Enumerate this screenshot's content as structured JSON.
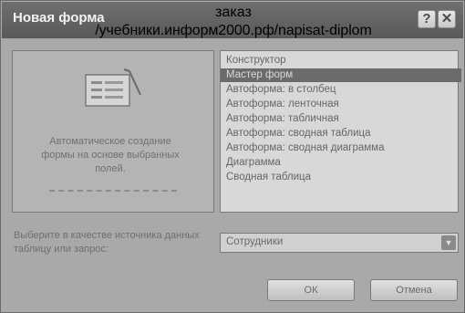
{
  "window": {
    "title": "Новая форма",
    "help_glyph": "?",
    "close_glyph": "✕"
  },
  "watermark": {
    "line1": "заказ",
    "line2": "/учебники.информ2000.рф/napisat-diplom"
  },
  "preview": {
    "description": "Автоматическое создание формы на основе выбранных полей."
  },
  "form_types": [
    {
      "label": "Конструктор",
      "selected": false
    },
    {
      "label": "Мастер форм",
      "selected": true
    },
    {
      "label": "Автоформа: в столбец",
      "selected": false
    },
    {
      "label": "Автоформа: ленточная",
      "selected": false
    },
    {
      "label": "Автоформа: табличная",
      "selected": false
    },
    {
      "label": "Автоформа: сводная таблица",
      "selected": false
    },
    {
      "label": "Автоформа: сводная диаграмма",
      "selected": false
    },
    {
      "label": "Диаграмма",
      "selected": false
    },
    {
      "label": "Сводная таблица",
      "selected": false
    }
  ],
  "source": {
    "label": "Выберите в качестве источника данных таблицу или запрос:",
    "value": "Сотрудники"
  },
  "buttons": {
    "ok": "ОК",
    "cancel": "Отмена"
  },
  "colors": {
    "titlebar": "#595959",
    "selected_item": "#6b6b6b"
  }
}
